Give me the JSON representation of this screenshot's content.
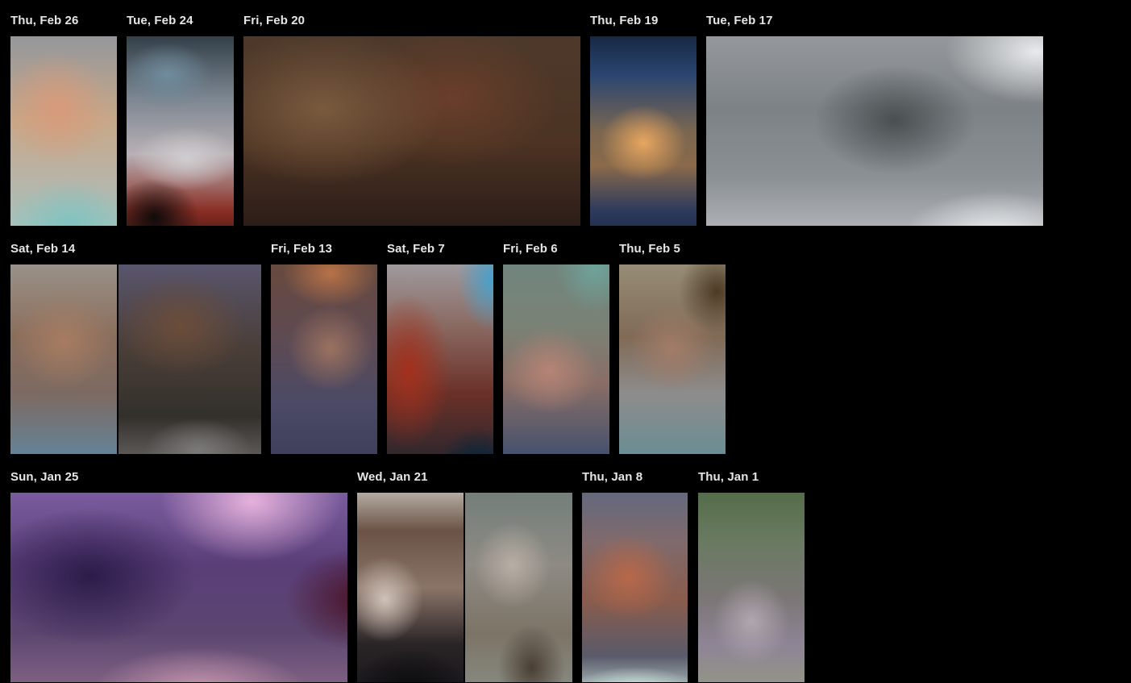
{
  "gallery": {
    "groups": [
      {
        "date": "Thu, Feb 26",
        "photo_count": 1
      },
      {
        "date": "Tue, Feb 24",
        "photo_count": 1
      },
      {
        "date": "Fri, Feb 20",
        "photo_count": 1
      },
      {
        "date": "Thu, Feb 19",
        "photo_count": 1
      },
      {
        "date": "Tue, Feb 17",
        "photo_count": 1
      },
      {
        "date": "Sat, Feb 14",
        "photo_count": 2
      },
      {
        "date": "Fri, Feb 13",
        "photo_count": 1
      },
      {
        "date": "Sat, Feb 7",
        "photo_count": 1
      },
      {
        "date": "Fri, Feb 6",
        "photo_count": 1
      },
      {
        "date": "Thu, Feb 5",
        "photo_count": 1
      },
      {
        "date": "Sun, Jan 25",
        "photo_count": 1
      },
      {
        "date": "Wed, Jan 21",
        "photo_count": 2
      },
      {
        "date": "Thu, Jan 8",
        "photo_count": 1
      },
      {
        "date": "Thu, Jan 1",
        "photo_count": 1
      }
    ]
  },
  "colors": {
    "background": "#000000",
    "label_text": "#e6e6e6"
  }
}
